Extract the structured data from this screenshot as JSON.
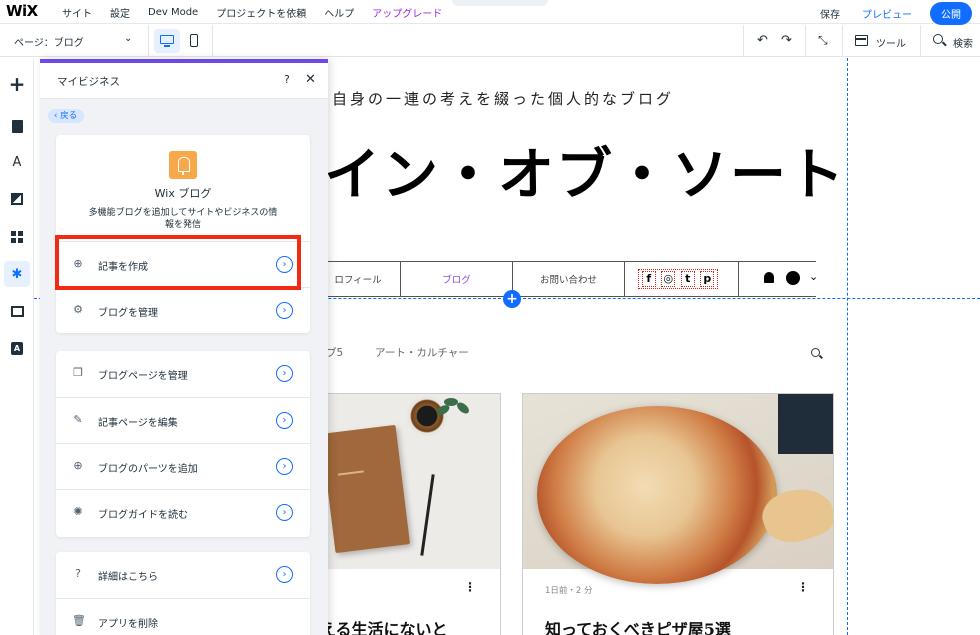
{
  "topbar": {
    "logo": "WiX",
    "menu": [
      "サイト",
      "設定",
      "Dev Mode",
      "プロジェクトを依頼",
      "ヘルプ",
      "アップグレード"
    ],
    "save": "保存",
    "preview": "プレビュー",
    "publish": "公開"
  },
  "toolbar": {
    "page_selector": "ページ：ブログ",
    "tools": "ツール",
    "search": "検索"
  },
  "site": {
    "tagline": "自身の一連の考えを綴った個人的なブログ",
    "title": "イン・オブ・ソート",
    "nav": [
      "ロフィール",
      "ブログ",
      "お問い合わせ"
    ],
    "nav_active_index": 1,
    "social": [
      "f",
      "◎",
      "t",
      "p"
    ],
    "categories": [
      "ブ5",
      "アート・カルチャー"
    ],
    "posts": [
      {
        "meta": "",
        "title": "える生活にないと"
      },
      {
        "meta": "1日前・2 分",
        "title": "知っておくべきピザ屋5選"
      }
    ]
  },
  "panel": {
    "title": "マイビジネス",
    "help": "?",
    "close": "✕",
    "back": "戻る",
    "app_name": "Wix ブログ",
    "app_desc": "多機能ブログを追加してサイトやビジネスの情報を発信",
    "box1_items": [
      {
        "icon": "plus-circle-icon",
        "label": "記事を作成"
      },
      {
        "icon": "gear-icon",
        "label": "ブログを管理"
      }
    ],
    "box2_items": [
      {
        "icon": "pages-icon",
        "label": "ブログページを管理"
      },
      {
        "icon": "brush-icon",
        "label": "記事ページを編集"
      },
      {
        "icon": "plus-circle-icon",
        "label": "ブログのパーツを追加"
      },
      {
        "icon": "lightbulb-icon",
        "label": "ブログガイドを読む"
      }
    ],
    "box3_items": [
      {
        "icon": "question-icon",
        "label": "詳細はこちら"
      },
      {
        "icon": "trash-icon",
        "label": "アプリを削除"
      }
    ]
  },
  "colors": {
    "accent": "#116dff",
    "panel_top": "#6f49e8",
    "highlight": "#f12a14",
    "upgrade": "#9a27d5"
  }
}
